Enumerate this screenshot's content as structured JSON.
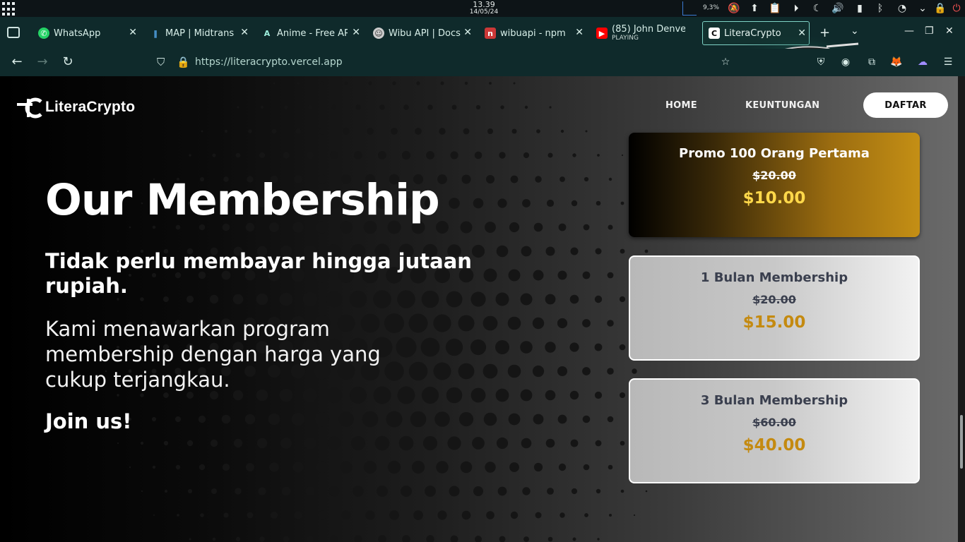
{
  "system": {
    "time": "13.39",
    "date": "14/05/24",
    "cpu_percent": "9,3%"
  },
  "browser": {
    "tabs": [
      {
        "label": "WhatsApp",
        "icon": "whatsapp-icon"
      },
      {
        "label": "MAP | Midtrans",
        "icon": "midtrans-icon"
      },
      {
        "label": "Anime - Free AP",
        "icon": "anime-api-icon"
      },
      {
        "label": "Wibu API | Docs",
        "icon": "wibu-avatar-icon"
      },
      {
        "label": "wibuapi - npm",
        "icon": "npm-icon"
      },
      {
        "label": "(85) John Denve",
        "sublabel": "PLAYING",
        "icon": "youtube-icon"
      },
      {
        "label": "LiteraCrypto",
        "icon": "literacrypto-icon",
        "active": true
      }
    ],
    "url": "https://literacrypto.vercel.app"
  },
  "site": {
    "brand": "LiteraCrypto",
    "nav": {
      "home": "HOME",
      "benefits": "KEUNTUNGAN",
      "register": "DAFTAR"
    },
    "hero": {
      "title": "Our Membership",
      "subtitle": "Tidak perlu membayar hingga jutaan rupiah.",
      "description": "Kami menawarkan program membership dengan harga yang cukup terjangkau.",
      "cta_text": "Join us!"
    },
    "plans": [
      {
        "name": "Promo 100 Orang Pertama",
        "old_price": "$20.00",
        "price": "$10.00"
      },
      {
        "name": "1 Bulan Membership",
        "old_price": "$20.00",
        "price": "$15.00"
      },
      {
        "name": "3 Bulan Membership",
        "old_price": "$60.00",
        "price": "$40.00"
      }
    ]
  },
  "colors": {
    "accent_gold": "#c48a10",
    "promo_price": "#ffd84a",
    "tab_bar": "#0f2a2b"
  }
}
